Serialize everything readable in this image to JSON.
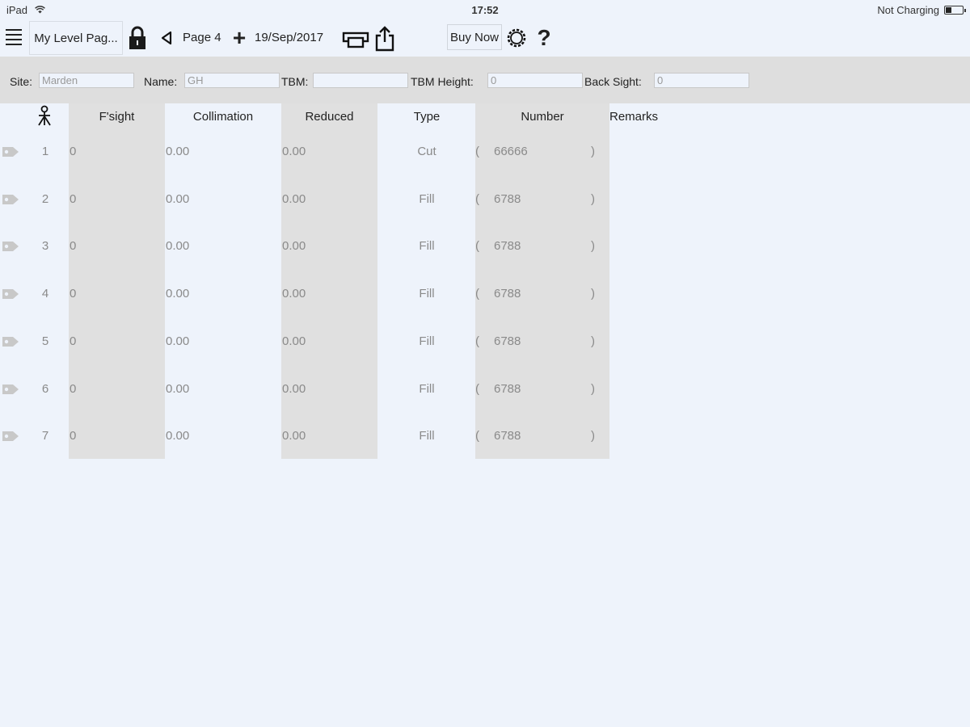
{
  "status_bar": {
    "device": "iPad",
    "time": "17:52",
    "charging": "Not Charging",
    "battery_level": 0.35
  },
  "toolbar": {
    "title": "My Level Pag...",
    "page_label": "Page 4",
    "date": "19/Sep/2017",
    "buy_label": "Buy Now",
    "help_label": "?",
    "add_label": "+"
  },
  "fields": {
    "site_label": "Site:",
    "site_value": "Marden",
    "name_label": "Name:",
    "name_value": "GH",
    "tbm_label": "TBM:",
    "tbm_value": "",
    "tbm_height_label": "TBM Height:",
    "tbm_height_value": "0",
    "back_sight_label": "Back Sight:",
    "back_sight_value": "0"
  },
  "table": {
    "headers": {
      "fsight": "F'sight",
      "collimation": "Collimation",
      "reduced": "Reduced",
      "type": "Type",
      "number": "Number",
      "remarks": "Remarks"
    },
    "rows": [
      {
        "index": "1",
        "fsight": "0",
        "collimation": "0.00",
        "reduced": "0.00",
        "type": "Cut",
        "open": "(",
        "number": "66666",
        "close": ")"
      },
      {
        "index": "2",
        "fsight": "0",
        "collimation": "0.00",
        "reduced": "0.00",
        "type": "Fill",
        "open": "(",
        "number": "6788",
        "close": ")"
      },
      {
        "index": "3",
        "fsight": "0",
        "collimation": "0.00",
        "reduced": "0.00",
        "type": "Fill",
        "open": "(",
        "number": "6788",
        "close": ")"
      },
      {
        "index": "4",
        "fsight": "0",
        "collimation": "0.00",
        "reduced": "0.00",
        "type": "Fill",
        "open": "(",
        "number": "6788",
        "close": ")"
      },
      {
        "index": "5",
        "fsight": "0",
        "collimation": "0.00",
        "reduced": "0.00",
        "type": "Fill",
        "open": "(",
        "number": "6788",
        "close": ")"
      },
      {
        "index": "6",
        "fsight": "0",
        "collimation": "0.00",
        "reduced": "0.00",
        "type": "Fill",
        "open": "(",
        "number": "6788",
        "close": ")"
      },
      {
        "index": "7",
        "fsight": "0",
        "collimation": "0.00",
        "reduced": "0.00",
        "type": "Fill",
        "open": "(",
        "number": "6788",
        "close": ")"
      }
    ]
  },
  "icons": {
    "menu": "menu-icon",
    "lock": "lock-icon",
    "back": "triangle-left-icon",
    "print": "print-icon",
    "share": "share-icon",
    "settings": "gear-icon",
    "staff": "level-staff-icon",
    "row_tag": "tag-icon"
  },
  "colors": {
    "background": "#eef3fb",
    "column_shade": "#e0e0e0",
    "field_bar": "#dedede",
    "muted_text": "#8a8a8a"
  }
}
